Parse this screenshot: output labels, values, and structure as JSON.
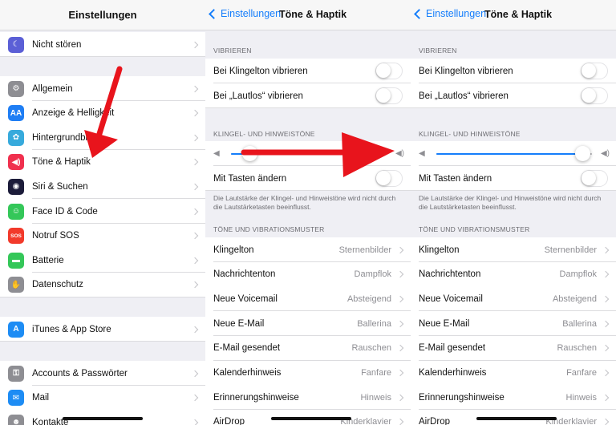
{
  "panel1": {
    "title": "Einstellungen",
    "groups": [
      [
        {
          "icon": "moon-icon",
          "color": "#5b5fd6",
          "glyph": "☾",
          "label": "Nicht stören"
        }
      ],
      [
        {
          "icon": "gear-icon",
          "color": "#8e8e93",
          "glyph": "⚙",
          "label": "Allgemein"
        },
        {
          "icon": "display-icon",
          "color": "#1f7ef4",
          "glyph": "AA",
          "label": "Anzeige & Helligkeit"
        },
        {
          "icon": "wallpaper-icon",
          "color": "#37aadc",
          "glyph": "✿",
          "label": "Hintergrundbild"
        },
        {
          "icon": "sound-icon",
          "color": "#f0304e",
          "glyph": "◀)",
          "label": "Töne & Haptik"
        },
        {
          "icon": "siri-icon",
          "color": "#1c1c3a",
          "glyph": "◉",
          "label": "Siri & Suchen"
        },
        {
          "icon": "faceid-icon",
          "color": "#34c759",
          "glyph": "☺",
          "label": "Face ID & Code"
        },
        {
          "icon": "sos-icon",
          "color": "#f23a2b",
          "glyph": "SOS",
          "label": "Notruf SOS"
        },
        {
          "icon": "battery-icon",
          "color": "#34c759",
          "glyph": "▬",
          "label": "Batterie"
        },
        {
          "icon": "privacy-hand-icon",
          "color": "#8e8e93",
          "glyph": "✋",
          "label": "Datenschutz"
        }
      ],
      [
        {
          "icon": "appstore-icon",
          "color": "#1d8cf4",
          "glyph": "A",
          "label": "iTunes & App Store"
        }
      ],
      [
        {
          "icon": "key-icon",
          "color": "#8e8e93",
          "glyph": "⚿",
          "label": "Accounts & Passwörter"
        },
        {
          "icon": "mail-icon",
          "color": "#1d8cf4",
          "glyph": "✉",
          "label": "Mail"
        },
        {
          "icon": "contacts-icon",
          "color": "#8e8e93",
          "glyph": "☻",
          "label": "Kontakte"
        }
      ]
    ]
  },
  "sound": {
    "back_label": "Einstellungen",
    "title": "Töne & Haptik",
    "vibrate_header": "VIBRIEREN",
    "vibrate_ring": "Bei Klingelton vibrieren",
    "vibrate_silent": "Bei „Lautlos“ vibrieren",
    "ringer_header": "KLINGEL- UND HINWEISTÖNE",
    "change_with_buttons": "Mit Tasten ändern",
    "footer_note": "Die Lautstärke der Klingel- und Hinweistöne wird nicht durch die Lautstärketasten beeinflusst.",
    "patterns_header": "TÖNE UND VIBRATIONSMUSTER",
    "patterns": [
      {
        "label": "Klingelton",
        "value": "Sternenbilder"
      },
      {
        "label": "Nachrichtenton",
        "value": "Dampflok"
      },
      {
        "label": "Neue Voicemail",
        "value": "Absteigend"
      },
      {
        "label": "Neue E-Mail",
        "value": "Ballerina"
      },
      {
        "label": "E-Mail gesendet",
        "value": "Rauschen"
      },
      {
        "label": "Kalenderhinweis",
        "value": "Fanfare"
      },
      {
        "label": "Erinnerungshinweise",
        "value": "Hinweis"
      },
      {
        "label": "AirDrop",
        "value": "Kinderklavier"
      }
    ]
  },
  "volume": {
    "panel2_level": 0.12,
    "panel3_level": 0.94
  },
  "colors": {
    "accent": "#157efb",
    "arrow": "#e8141c"
  }
}
